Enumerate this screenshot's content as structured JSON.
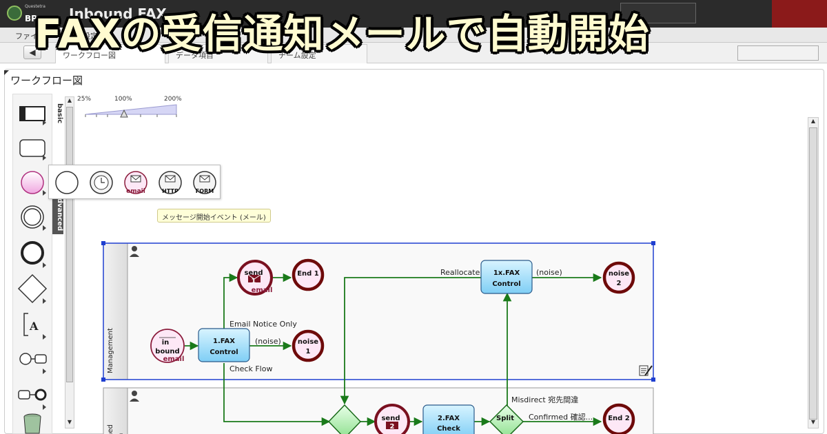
{
  "app": {
    "logo_small": "Questetra",
    "logo_text": "BP",
    "title": "Inbound FAX",
    "headline": "FAXの受信通知メールで自動開始"
  },
  "menu": {
    "file": "ファイ",
    "other": "設定"
  },
  "tabs": {
    "back_icon": "back-arrow-icon",
    "active": "ワークフロー図",
    "second": "データ項目",
    "third": "チーム設定"
  },
  "panel": {
    "title": "ワークフロー図"
  },
  "palette": {
    "tab_basic": "basic",
    "tab_advanced": "advanced",
    "items": [
      "task-icon",
      "subprocess-icon",
      "start-event-icon",
      "intermediate-event-icon",
      "end-event-icon",
      "gateway-icon",
      "annotation-icon",
      "message-start-icon",
      "message-end-icon",
      "data-store-icon"
    ]
  },
  "flyout": {
    "items": [
      {
        "name": "none-start-icon",
        "label": ""
      },
      {
        "name": "timer-start-icon",
        "label": ""
      },
      {
        "name": "email-start-icon",
        "label": "email"
      },
      {
        "name": "http-start-icon",
        "label": "HTTP"
      },
      {
        "name": "form-start-icon",
        "label": "FORM"
      }
    ],
    "tooltip": "メッセージ開始イベント (メール)"
  },
  "zoom": {
    "min": "25%",
    "mid": "100%",
    "max": "200%",
    "level_percent": 100
  },
  "diagram": {
    "lane1": "Management",
    "lane2_part1": "ned",
    "lane2_part2": "n",
    "nodes": {
      "inbound": {
        "line1": "in",
        "line2": "bound",
        "tag": "email"
      },
      "fax_control": {
        "line1": "1.FAX",
        "line2": "Control"
      },
      "send1": {
        "line1": "send",
        "line2": "1",
        "tag": "email"
      },
      "end1": {
        "line1": "End 1"
      },
      "noise1": {
        "line1": "noise",
        "line2": "1"
      },
      "fax_control_x": {
        "line1": "1x.FAX",
        "line2": "Control"
      },
      "noise2": {
        "line1": "noise",
        "line2": "2"
      },
      "send_bottom": {
        "line1": "send",
        "line2": "2"
      },
      "fax_check": {
        "line1": "2.FAX",
        "line2": "Check"
      },
      "split": {
        "line1": "Split"
      },
      "end2": {
        "line1": "End 2"
      }
    },
    "edges": {
      "email_notice": "Email Notice Only",
      "noise_a": "(noise)",
      "check_flow": "Check Flow",
      "reallocate": "Reallocate",
      "noise_b": "(noise)",
      "misdirect": "Misdirect 宛先間違",
      "confirmed": "Confirmed 確認..."
    }
  }
}
